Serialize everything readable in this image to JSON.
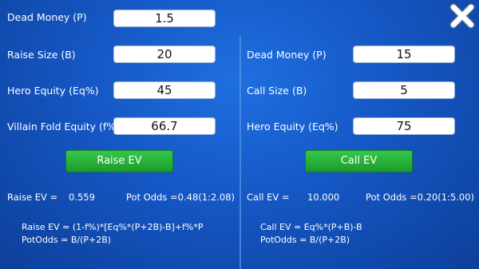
{
  "left": {
    "dead_money": {
      "label": "Dead Money (P)",
      "value": "1.5"
    },
    "raise_size": {
      "label": "Raise Size (B)",
      "value": "20"
    },
    "hero_equity": {
      "label": "Hero Equity (Eq%)",
      "value": "45"
    },
    "fold_equity": {
      "label": "Villain Fold Equity (f%)",
      "value": "66.7"
    },
    "button_label": "Raise EV",
    "result_label": "Raise EV =",
    "result_value": "0.559",
    "pot_odds": "Pot Odds =0.48(1:2.08)",
    "formula_ev": "Raise EV = (1-f%)*[Eq%*(P+2B)-B]+f%*P",
    "formula_odds": "PotOdds = B/(P+2B)"
  },
  "right": {
    "dead_money": {
      "label": "Dead Money (P)",
      "value": "15"
    },
    "call_size": {
      "label": "Call Size (B)",
      "value": "5"
    },
    "hero_equity": {
      "label": "Hero Equity (Eq%)",
      "value": "75"
    },
    "button_label": "Call EV",
    "result_label": "Call EV =",
    "result_value": "10.000",
    "pot_odds": "Pot Odds =0.20(1:5.00)",
    "formula_ev": "Call EV = Eq%*(P+B)-B",
    "formula_odds": "PotOdds = B/(P+2B)"
  },
  "icons": {
    "close": "close-icon"
  },
  "colors": {
    "background": "#1557c4",
    "button": "#1e9a2c"
  }
}
